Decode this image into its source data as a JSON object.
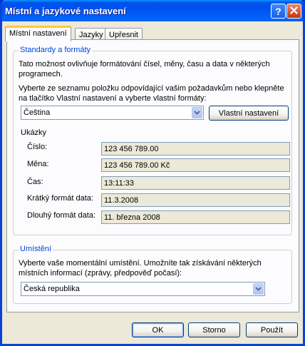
{
  "window": {
    "title": "Místní a jazykové nastavení"
  },
  "tabs": [
    {
      "label": "Místní nastavení"
    },
    {
      "label": "Jazyky"
    },
    {
      "label": "Upřesnit"
    }
  ],
  "standards": {
    "legend": "Standardy a formáty",
    "desc_line1": "Tato možnost ovlivňuje formátování čísel, měny, času a data v některých",
    "desc_line2": "programech.",
    "instr_line1": "Vyberte ze seznamu položku odpovídající vašim požadavkům nebo klepněte",
    "instr_line2": "na tlačítko Vlastní nastavení a vyberte vlastní formáty:",
    "selected_format": "Čeština",
    "custom_button": "Vlastní nastavení"
  },
  "samples": {
    "heading": "Ukázky",
    "rows": [
      {
        "label": "Číslo:",
        "value": "123 456 789.00"
      },
      {
        "label": "Měna:",
        "value": "123 456 789.00 Kč"
      },
      {
        "label": "Čas:",
        "value": "13:11:33"
      },
      {
        "label": "Krátký formát data:",
        "value": "11.3.2008"
      },
      {
        "label": "Dlouhý formát data:",
        "value": "11. března 2008"
      }
    ]
  },
  "location": {
    "legend": "Umístění",
    "desc_line1": "Vyberte vaše momentální umístění. Umožníte tak získávání některých",
    "desc_line2": "místních informací (zprávy, předpověď počasí):",
    "selected": "Česká republika"
  },
  "footer": {
    "ok": "OK",
    "cancel": "Storno",
    "apply": "Použít"
  }
}
